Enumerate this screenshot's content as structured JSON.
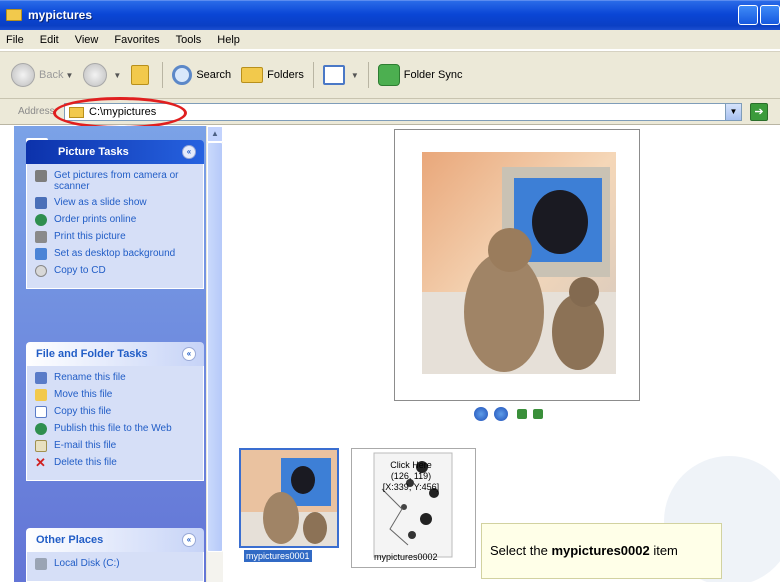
{
  "window": {
    "title": "mypictures"
  },
  "menu": [
    "File",
    "Edit",
    "View",
    "Favorites",
    "Tools",
    "Help"
  ],
  "toolbar": {
    "back": "Back",
    "search": "Search",
    "folders": "Folders",
    "folder_sync": "Folder Sync"
  },
  "address": {
    "label": "Address",
    "path": "C:\\mypictures"
  },
  "picture_tasks": {
    "title": "Picture Tasks",
    "items": [
      "Get pictures from camera or scanner",
      "View as a slide show",
      "Order prints online",
      "Print this picture",
      "Set as desktop background",
      "Copy to CD"
    ]
  },
  "file_folder_tasks": {
    "title": "File and Folder Tasks",
    "items": [
      "Rename this file",
      "Move this file",
      "Copy this file",
      "Publish this file to the Web",
      "E-mail this file",
      "Delete this file"
    ]
  },
  "other_places": {
    "title": "Other Places",
    "items": [
      "Local Disk (C:)"
    ]
  },
  "thumbnails": [
    {
      "label": "mypictures0001",
      "selected": true
    },
    {
      "label": "mypictures0002",
      "selected": false
    }
  ],
  "overlay": {
    "click_text_line1": "Click Here",
    "click_text_line2": "(126, 119)",
    "click_text_line3": "[X:339, Y:456]",
    "instruction_prefix": "Select the ",
    "instruction_bold": "mypictures0002",
    "instruction_suffix": " item"
  },
  "colors": {
    "title_bar": "#0a46d6",
    "side_pane": "#7ba2e7",
    "highlight": "#e01f1f"
  }
}
